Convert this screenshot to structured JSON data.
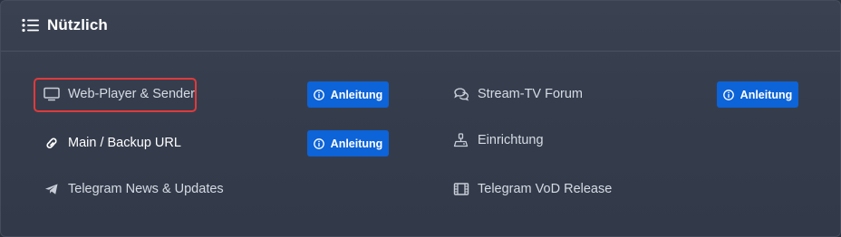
{
  "card": {
    "title": "Nützlich",
    "title_icon": "list-icon"
  },
  "links": {
    "web_player": {
      "label": "Web-Player & Sender",
      "icon": "monitor-icon"
    },
    "main_backup": {
      "label": "Main / Backup URL",
      "icon": "link-icon"
    },
    "telegram_news": {
      "label": "Telegram News & Updates",
      "icon": "telegram-icon"
    },
    "forum": {
      "label": "Stream-TV Forum",
      "icon": "comments-icon"
    },
    "setup": {
      "label": "Einrichtung",
      "icon": "setup-icon"
    },
    "telegram_vod": {
      "label": "Telegram VoD Release",
      "icon": "film-icon"
    }
  },
  "buttons": {
    "anleitung_1": "Anleitung",
    "anleitung_2": "Anleitung",
    "anleitung_3": "Anleitung"
  },
  "colors": {
    "accent_button": "#0d63d8",
    "highlight_border": "#e03a3a",
    "card_bg": "#353d4d"
  }
}
